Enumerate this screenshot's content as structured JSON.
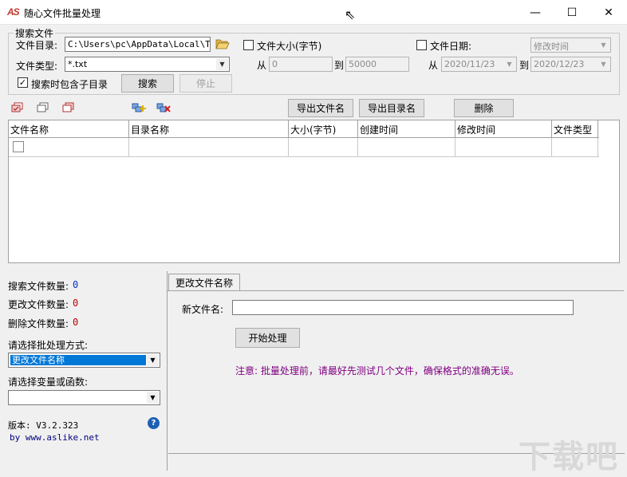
{
  "window": {
    "logo_text": "AS",
    "title": "随心文件批量处理",
    "minimize": "—",
    "maximize": "☐",
    "close": "✕"
  },
  "search_group": {
    "legend": "搜索文件",
    "dir_label": "文件目录:",
    "dir_value": "C:\\Users\\pc\\AppData\\Local\\Temp",
    "folder_icon": "folder-open-icon",
    "type_label": "文件类型:",
    "type_value": "*.txt",
    "include_sub_label": "搜索时包含子目录",
    "include_sub_checked": true,
    "search_btn": "搜索",
    "stop_btn": "停止",
    "size_label": "文件大小(字节)",
    "size_from_label": "从",
    "size_from": "0",
    "size_to_label": "到",
    "size_to": "50000",
    "date_label": "文件日期:",
    "date_type": "修改时间",
    "date_from_label": "从",
    "date_from": "2020/11/23",
    "date_to_label": "到",
    "date_to": "2020/12/23"
  },
  "toolbar": {
    "export_filename": "导出文件名",
    "export_dirname": "导出目录名",
    "delete": "删除"
  },
  "table": {
    "columns": [
      "文件名称",
      "目录名称",
      "大小(字节)",
      "创建时间",
      "修改时间",
      "文件类型"
    ]
  },
  "stats": {
    "search_count_label": "搜索文件数量:",
    "search_count": "0",
    "rename_count_label": "更改文件数量:",
    "rename_count": "0",
    "delete_count_label": "删除文件数量:",
    "delete_count": "0"
  },
  "options": {
    "method_label": "请选择批处理方式:",
    "method_value": "更改文件名称",
    "var_label": "请选择变量或函数:",
    "var_value": ""
  },
  "about": {
    "version": "版本: V3.2.323",
    "site": "by www.aslike.net"
  },
  "rename_tab": {
    "tab_label": "更改文件名称",
    "new_name_label": "新文件名:",
    "new_name_value": "",
    "start_btn": "开始处理",
    "note": "注意: 批量处理前，请最好先测试几个文件，确保格式的准确无误。"
  },
  "watermark": "下载吧"
}
